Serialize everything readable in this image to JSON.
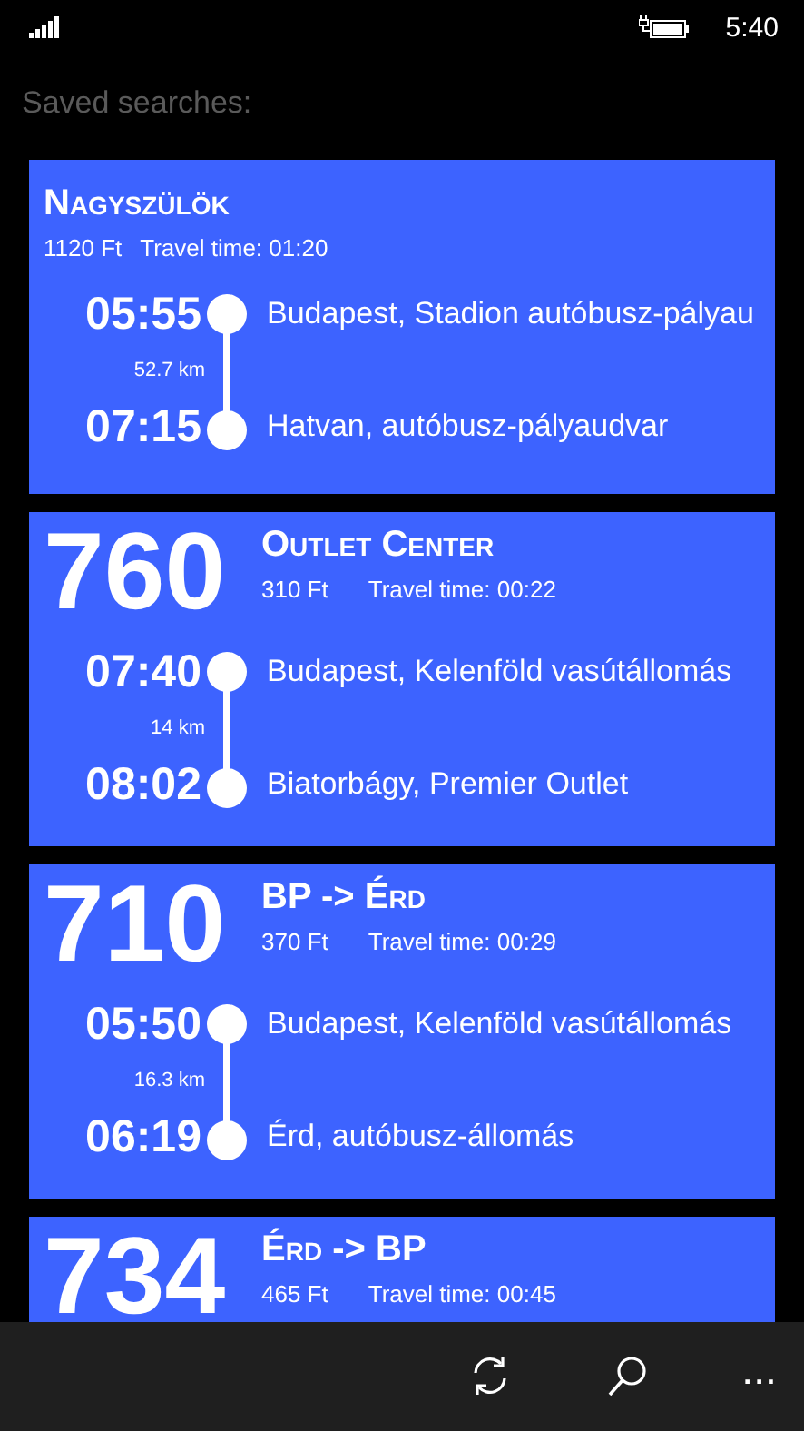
{
  "status_bar": {
    "time": "5:40"
  },
  "heading": "Saved searches:",
  "searches": [
    {
      "title": "Nagyszülök",
      "price": "1120 Ft",
      "travel_time": "Travel time: 01:20",
      "distance": "52.7 km",
      "stops": [
        {
          "time": "05:55",
          "name": "Budapest, Stadion autóbusz-pályau"
        },
        {
          "time": "07:15",
          "name": "Hatvan, autóbusz-pályaudvar"
        }
      ]
    },
    {
      "route": "760",
      "title": "Outlet Center",
      "price": "310 Ft",
      "travel_time": "Travel time: 00:22",
      "distance": "14 km",
      "stops": [
        {
          "time": "07:40",
          "name": "Budapest, Kelenföld vasútállomás"
        },
        {
          "time": "08:02",
          "name": "Biatorbágy, Premier Outlet"
        }
      ]
    },
    {
      "route": "710",
      "title": "BP -> Érd",
      "price": "370 Ft",
      "travel_time": "Travel time: 00:29",
      "distance": "16.3 km",
      "stops": [
        {
          "time": "05:50",
          "name": "Budapest, Kelenföld vasútállomás"
        },
        {
          "time": "06:19",
          "name": "Érd, autóbusz-állomás"
        }
      ]
    },
    {
      "route": "734",
      "title": "Érd -> BP",
      "price": "465 Ft",
      "travel_time": "Travel time: 00:45"
    }
  ],
  "app_bar": {
    "buttons": [
      {
        "kind": "refresh"
      },
      {
        "kind": "search"
      }
    ],
    "more": "..."
  }
}
